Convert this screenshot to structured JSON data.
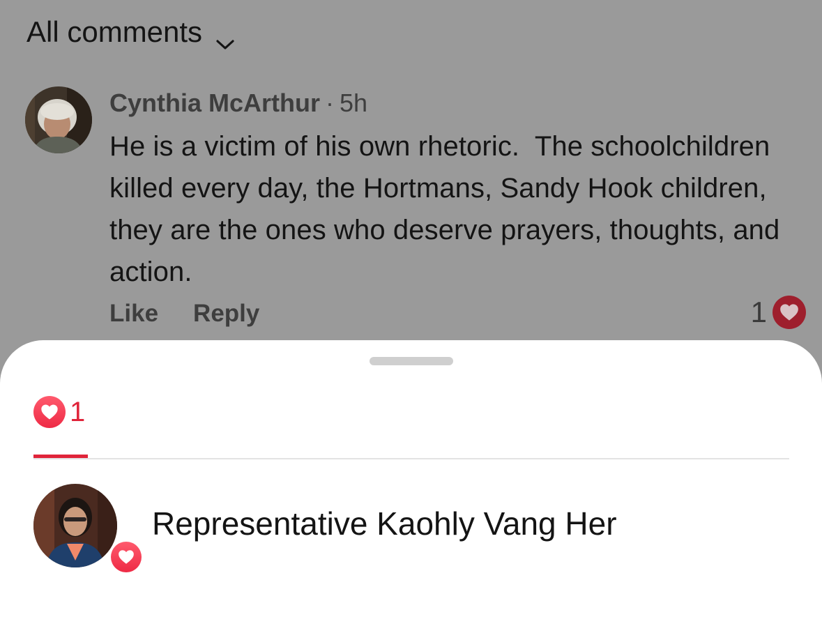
{
  "header": {
    "title": "All comments",
    "dropdown_icon": "chevron-down-icon"
  },
  "comment": {
    "author": "Cynthia McArthur",
    "separator": "·",
    "time": "5h",
    "text": "He is a victim of his own rhetoric.  The schoolchildren killed every day, the Hortmans, Sandy Hook children, they are the ones who deserve prayers, thoughts, and action.",
    "actions": {
      "like": "Like",
      "reply": "Reply"
    },
    "reaction_count": "1",
    "reaction_icon": "heart-icon"
  },
  "sheet": {
    "tabs": [
      {
        "icon": "heart-icon",
        "count": "1",
        "selected": true
      }
    ],
    "reactors": [
      {
        "name": "Representative Kaohly Vang Her",
        "reaction": "heart-icon"
      }
    ]
  },
  "colors": {
    "accent": "#e0243a",
    "overlay_background": "#9a9a9a",
    "sheet_background": "#ffffff"
  }
}
